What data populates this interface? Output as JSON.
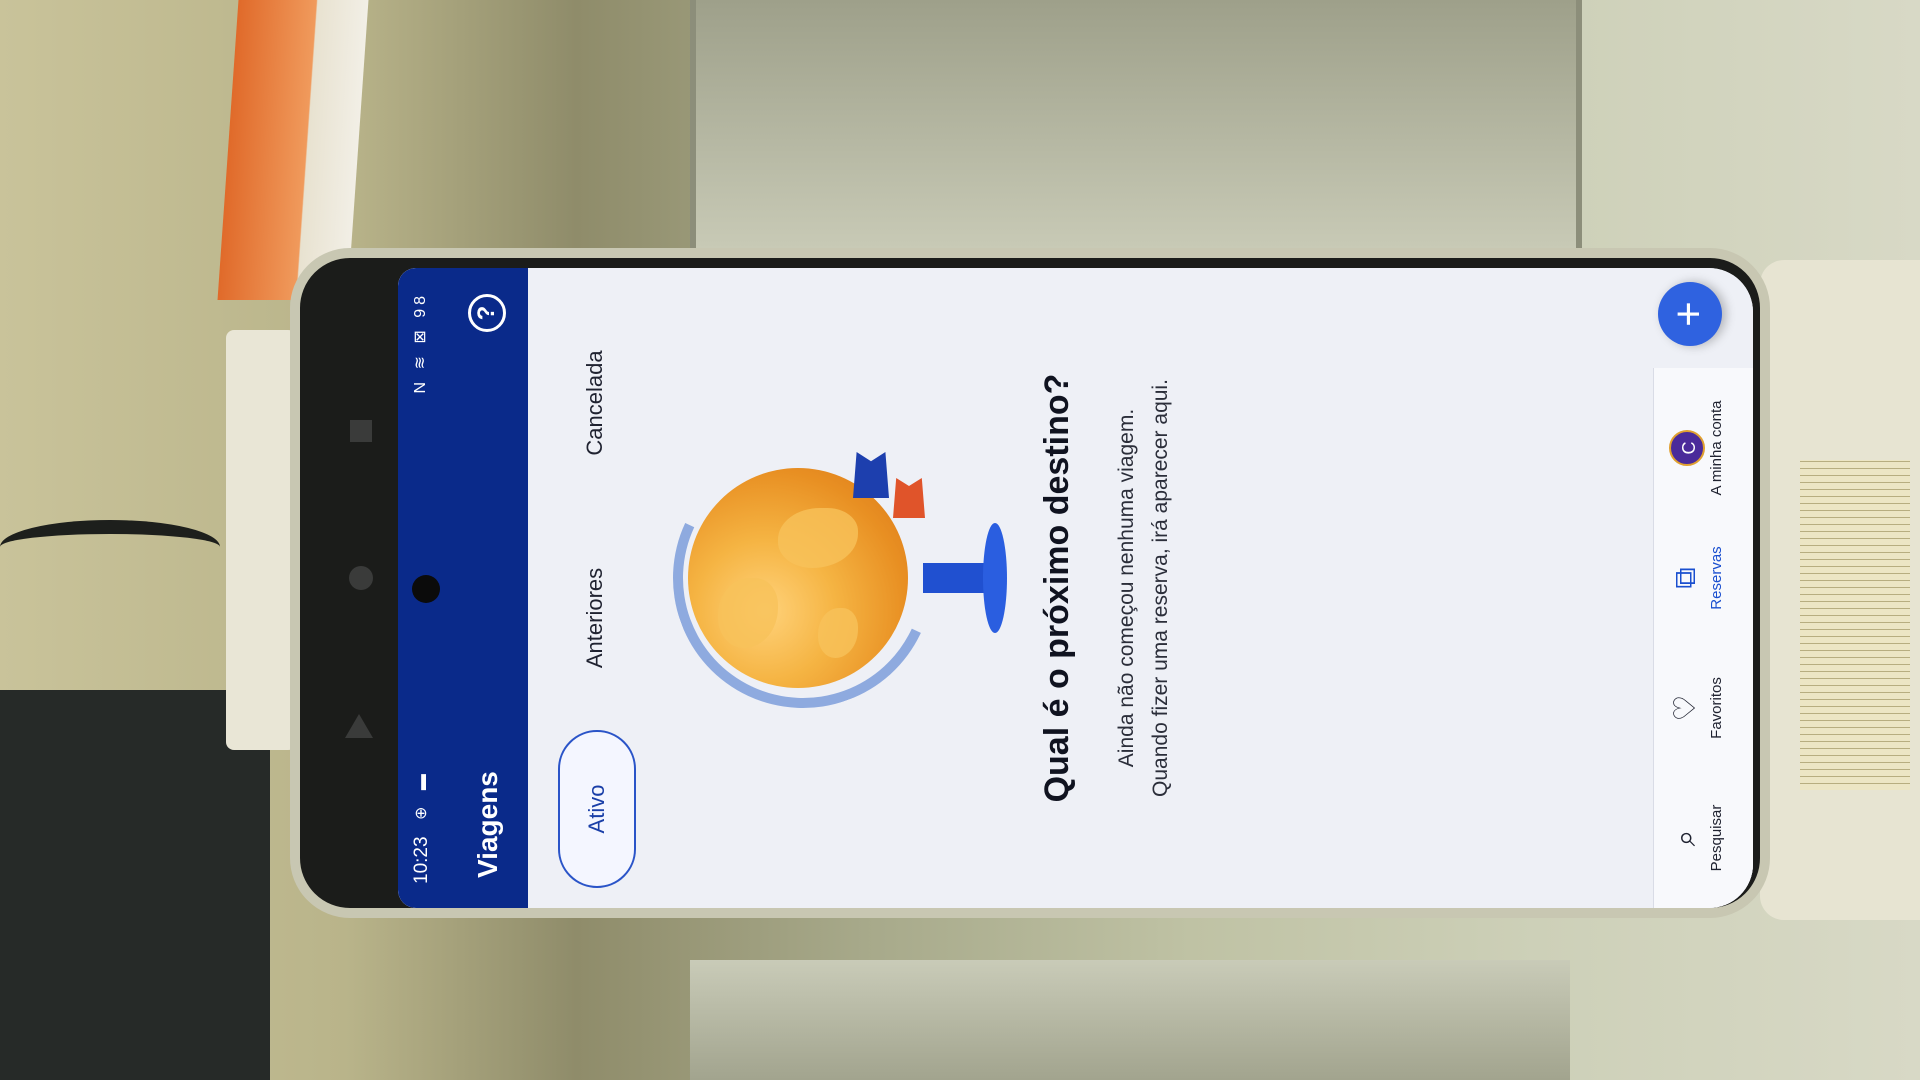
{
  "status_bar": {
    "time": "10:23",
    "battery": "98"
  },
  "app_bar": {
    "title": "Viagens",
    "help_label": "?"
  },
  "tabs": [
    {
      "label": "Ativo",
      "active": true
    },
    {
      "label": "Anteriores",
      "active": false
    },
    {
      "label": "Cancelada",
      "active": false
    }
  ],
  "empty_state": {
    "headline": "Qual é o próximo destino?",
    "line1": "Ainda não começou nenhuma viagem.",
    "line2": "Quando fizer uma reserva, irá aparecer aqui."
  },
  "fab": {
    "label": "+"
  },
  "bottom_nav": [
    {
      "label": "Pesquisar",
      "icon": "search-icon"
    },
    {
      "label": "Favoritos",
      "icon": "heart-icon"
    },
    {
      "label": "Reservas",
      "icon": "suitcase-icon",
      "active": true
    },
    {
      "label": "A minha conta",
      "icon": "avatar",
      "avatar_letter": "C"
    }
  ],
  "colors": {
    "brand": "#0a2a8a",
    "accent": "#2f62e0",
    "active_tab": "#1a3fa8"
  }
}
